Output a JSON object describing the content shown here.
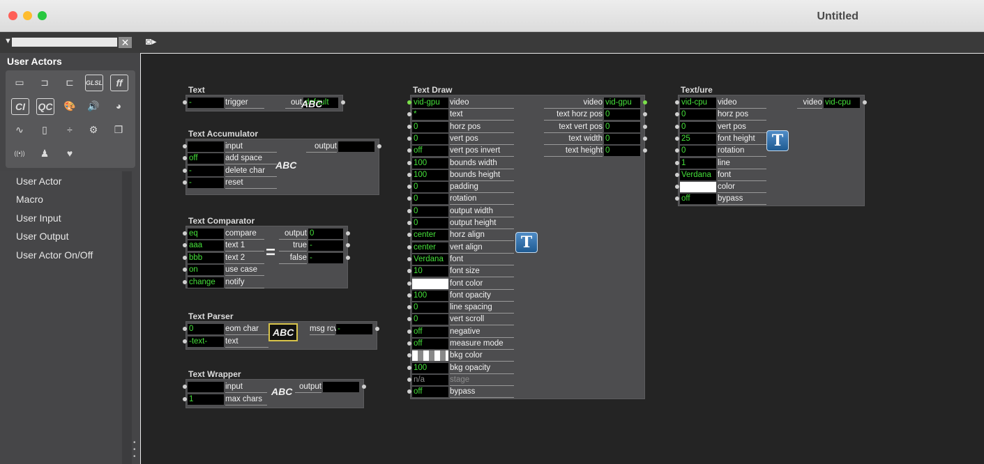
{
  "window": {
    "title": "Untitled"
  },
  "sidebar": {
    "header": "User Actors",
    "search_placeholder": "",
    "icons": [
      {
        "name": "rectangle-icon",
        "glyph": "▭"
      },
      {
        "name": "input-bracket-icon",
        "glyph": "⊐"
      },
      {
        "name": "output-bracket-icon",
        "glyph": "⊏"
      },
      {
        "name": "glsl-icon",
        "glyph": "GLSL"
      },
      {
        "name": "ff-icon",
        "glyph": "ff"
      },
      {
        "name": "ci-icon",
        "glyph": "CI"
      },
      {
        "name": "qc-icon",
        "glyph": "QC"
      },
      {
        "name": "palette-icon",
        "glyph": "🎨"
      },
      {
        "name": "speaker-icon",
        "glyph": "🔊"
      },
      {
        "name": "color-wheel-icon",
        "glyph": "◕"
      },
      {
        "name": "wave-icon",
        "glyph": "∿"
      },
      {
        "name": "mouse-icon",
        "glyph": "▯"
      },
      {
        "name": "divide-icon",
        "glyph": "÷"
      },
      {
        "name": "gear-icon",
        "glyph": "⚙"
      },
      {
        "name": "stack-icon",
        "glyph": "❐"
      },
      {
        "name": "antenna-icon",
        "glyph": "((•))"
      },
      {
        "name": "person-icon",
        "glyph": "♟"
      },
      {
        "name": "heart-icon",
        "glyph": "♥"
      }
    ],
    "items": [
      "User Actor",
      "Macro",
      "User Input",
      "User Output",
      "User Actor On/Off"
    ]
  },
  "actors": [
    {
      "title": "Text",
      "inputs": [
        {
          "value": "-",
          "label": "trigger"
        }
      ],
      "icon_text": "ABC",
      "outputs": [
        {
          "label": "out",
          "value": "default"
        }
      ]
    },
    {
      "title": "Text Accumulator",
      "inputs": [
        {
          "value": "",
          "label": "input"
        },
        {
          "value": "off",
          "label": "add space"
        },
        {
          "value": "-",
          "label": "delete char"
        },
        {
          "value": "-",
          "label": "reset"
        }
      ],
      "icon_text": "ABC",
      "outputs": [
        {
          "label": "output",
          "value": ""
        }
      ]
    },
    {
      "title": "Text Comparator",
      "inputs": [
        {
          "value": "eq",
          "label": "compare"
        },
        {
          "value": "aaa",
          "label": "text 1"
        },
        {
          "value": "bbb",
          "label": "text 2"
        },
        {
          "value": "on",
          "label": "use case"
        },
        {
          "value": "change",
          "label": "notify"
        }
      ],
      "outputs": [
        {
          "label": "output",
          "value": "0"
        },
        {
          "label": "true",
          "value": "-"
        },
        {
          "label": "false",
          "value": "-"
        }
      ]
    },
    {
      "title": "Text Parser",
      "inputs": [
        {
          "value": "0",
          "label": "eom char"
        },
        {
          "value": "-text-",
          "label": "text"
        }
      ],
      "icon_text": "ABC",
      "outputs": [
        {
          "label": "msg rcv",
          "value": "-"
        }
      ]
    },
    {
      "title": "Text Wrapper",
      "inputs": [
        {
          "value": "",
          "label": "input"
        },
        {
          "value": "1",
          "label": "max chars"
        }
      ],
      "icon_text": "ABC",
      "outputs": [
        {
          "label": "output",
          "value": ""
        }
      ]
    },
    {
      "title": "Text Draw",
      "inputs": [
        {
          "value": "vid-gpu",
          "label": "video"
        },
        {
          "value": "*",
          "label": "text"
        },
        {
          "value": "0",
          "label": "horz pos"
        },
        {
          "value": "0",
          "label": "vert pos"
        },
        {
          "value": "off",
          "label": "vert pos invert"
        },
        {
          "value": "100",
          "label": "bounds width"
        },
        {
          "value": "100",
          "label": "bounds height"
        },
        {
          "value": "0",
          "label": "padding"
        },
        {
          "value": "0",
          "label": "rotation"
        },
        {
          "value": "0",
          "label": "output width"
        },
        {
          "value": "0",
          "label": "output height"
        },
        {
          "value": "center",
          "label": "horz align"
        },
        {
          "value": "center",
          "label": "vert align"
        },
        {
          "value": "Verdana",
          "label": "font"
        },
        {
          "value": "10",
          "label": "font size"
        },
        {
          "value": "",
          "label": "font color"
        },
        {
          "value": "100",
          "label": "font opacity"
        },
        {
          "value": "0",
          "label": "line spacing"
        },
        {
          "value": "0",
          "label": "vert scroll"
        },
        {
          "value": "off",
          "label": "negative"
        },
        {
          "value": "off",
          "label": "measure mode"
        },
        {
          "value": "",
          "label": "bkg color"
        },
        {
          "value": "100",
          "label": "bkg opacity"
        },
        {
          "value": "n/a",
          "label": "stage"
        },
        {
          "value": "off",
          "label": "bypass"
        }
      ],
      "outputs": [
        {
          "label": "video",
          "value": "vid-gpu"
        },
        {
          "label": "text horz pos",
          "value": "0"
        },
        {
          "label": "text vert pos",
          "value": "0"
        },
        {
          "label": "text width",
          "value": "0"
        },
        {
          "label": "text height",
          "value": "0"
        }
      ]
    },
    {
      "title": "Text/ure",
      "inputs": [
        {
          "value": "vid-cpu",
          "label": "video"
        },
        {
          "value": "0",
          "label": "horz pos"
        },
        {
          "value": "0",
          "label": "vert pos"
        },
        {
          "value": "25",
          "label": "font height"
        },
        {
          "value": "0",
          "label": "rotation"
        },
        {
          "value": "1",
          "label": "line"
        },
        {
          "value": "Verdana",
          "label": "font"
        },
        {
          "value": "",
          "label": "color"
        },
        {
          "value": "off",
          "label": "bypass"
        }
      ],
      "outputs": [
        {
          "label": "video",
          "value": "vid-cpu"
        }
      ]
    }
  ]
}
